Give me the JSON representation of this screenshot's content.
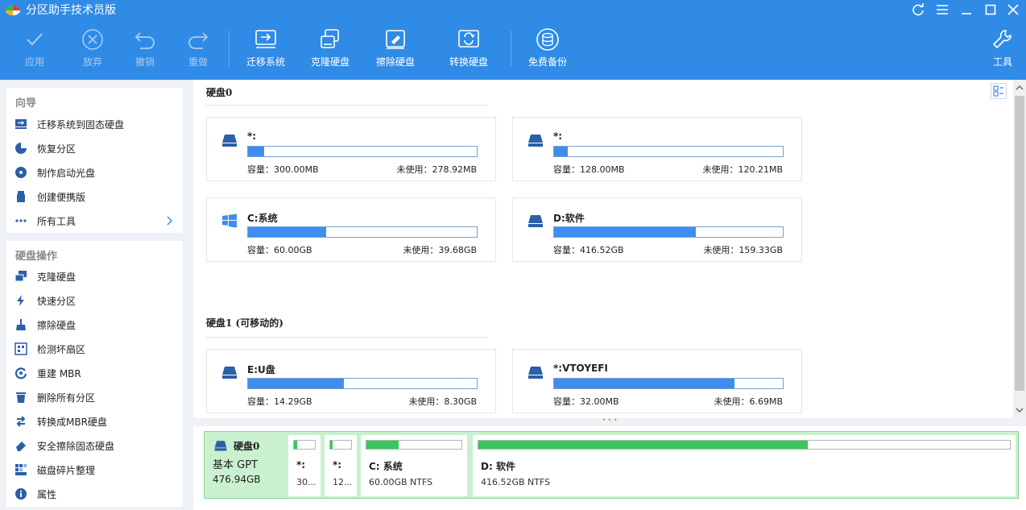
{
  "app": {
    "title": "分区助手技术员版"
  },
  "toolbar": {
    "apply": "应用",
    "discard": "放弃",
    "undo": "撤销",
    "redo": "重做",
    "migrate": "迁移系统",
    "clone": "克隆硬盘",
    "wipe": "擦除硬盘",
    "convert": "转换硬盘",
    "backup": "免费备份",
    "tools": "工具"
  },
  "sidebar": {
    "wizard_title": "向导",
    "wizard_items": [
      {
        "label": "迁移系统到固态硬盘"
      },
      {
        "label": "恢复分区"
      },
      {
        "label": "制作启动光盘"
      },
      {
        "label": "创建便携版"
      },
      {
        "label": "所有工具"
      }
    ],
    "disk_ops_title": "硬盘操作",
    "disk_ops_items": [
      {
        "label": "克隆硬盘"
      },
      {
        "label": "快速分区"
      },
      {
        "label": "擦除硬盘"
      },
      {
        "label": "检测坏扇区"
      },
      {
        "label": "重建 MBR"
      },
      {
        "label": "删除所有分区"
      },
      {
        "label": "转换成MBR硬盘"
      },
      {
        "label": "安全擦除固态硬盘"
      },
      {
        "label": "磁盘碎片整理"
      },
      {
        "label": "属性"
      }
    ]
  },
  "disks": [
    {
      "heading": "硬盘0",
      "partitions": [
        {
          "name": "*:",
          "capacity": "容量：300.00MB",
          "free": "未使用：278.92MB",
          "used_fraction": 0.07,
          "icon": "drive-icon"
        },
        {
          "name": "*:",
          "capacity": "容量：128.00MB",
          "free": "未使用：120.21MB",
          "used_fraction": 0.06,
          "icon": "drive-icon"
        },
        {
          "name": "C:系统",
          "capacity": "容量：60.00GB",
          "free": "未使用：39.68GB",
          "used_fraction": 0.34,
          "icon": "windows-icon"
        },
        {
          "name": "D:软件",
          "capacity": "容量：416.52GB",
          "free": "未使用：159.33GB",
          "used_fraction": 0.62,
          "icon": "drive-icon"
        }
      ]
    },
    {
      "heading": "硬盘1 (可移动的)",
      "partitions": [
        {
          "name": "E:U盘",
          "capacity": "容量：14.29GB",
          "free": "未使用：8.30GB",
          "used_fraction": 0.42,
          "icon": "drive-icon"
        },
        {
          "name": "*:VTOYEFI",
          "capacity": "容量：32.00MB",
          "free": "未使用：6.69MB",
          "used_fraction": 0.79,
          "icon": "drive-icon"
        }
      ]
    }
  ],
  "diskmap": {
    "disk_name": "硬盘0",
    "disk_type": "基本 GPT",
    "disk_size": "476.94GB",
    "segments": [
      {
        "name": "*:",
        "desc": "30...",
        "used_fraction": 0.15
      },
      {
        "name": "*:",
        "desc": "12...",
        "used_fraction": 0.1
      },
      {
        "name": "C: 系统",
        "desc": "60.00GB NTFS",
        "used_fraction": 0.34
      },
      {
        "name": "D: 软件",
        "desc": "416.52GB NTFS",
        "used_fraction": 0.62
      }
    ]
  },
  "colors": {
    "accent": "#2f8be6",
    "bar_fill": "#3d8ef0",
    "diskmap_bg": "#c9f0cf",
    "seg_fill": "#34c85a"
  }
}
